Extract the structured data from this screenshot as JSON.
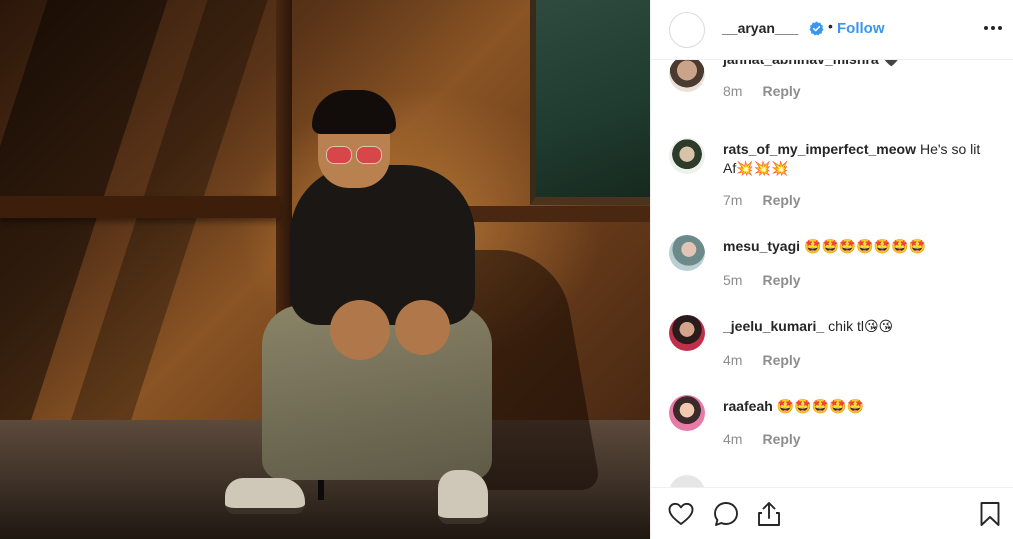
{
  "post": {
    "author": "__aryan___",
    "follow_label": "Follow",
    "separator": "•",
    "verified": true,
    "icons": {
      "verified": "verified-badge-icon",
      "more": "more-options-icon"
    }
  },
  "comments": [
    {
      "user": "jannat_abhinav_mishra",
      "text": "🖤",
      "time": "8m",
      "reply_label": "Reply"
    },
    {
      "user": "rats_of_my_imperfect_meow",
      "text": "He's so lit Af💥💥💥",
      "time": "7m",
      "reply_label": "Reply"
    },
    {
      "user": "mesu_tyagi",
      "text": "🤩🤩🤩🤩🤩🤩🤩",
      "time": "5m",
      "reply_label": "Reply"
    },
    {
      "user": "_jeelu_kumari_",
      "text": "chik tl😘😘",
      "time": "4m",
      "reply_label": "Reply"
    },
    {
      "user": "raafeah",
      "text": "🤩🤩🤩🤩🤩",
      "time": "4m",
      "reply_label": "Reply"
    }
  ],
  "actions": {
    "icons": [
      "heart-icon",
      "comment-icon",
      "share-icon",
      "bookmark-icon"
    ]
  },
  "colors": {
    "link": "#3897f0",
    "text": "#262626",
    "muted": "#8e8e8e",
    "border": "#efefef"
  }
}
